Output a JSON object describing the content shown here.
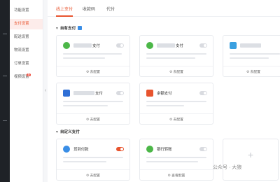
{
  "sidebar": {
    "items": [
      {
        "label": "功能设置",
        "active": false
      },
      {
        "label": "支付设置",
        "active": true
      },
      {
        "label": "配送设置",
        "active": false
      },
      {
        "label": "物流设置",
        "active": false
      },
      {
        "label": "订单设置",
        "active": false
      },
      {
        "label": "视频设置",
        "active": false,
        "badge": "新"
      }
    ]
  },
  "tabs": [
    {
      "label": "线上支付",
      "active": true
    },
    {
      "label": "收款码",
      "active": false
    },
    {
      "label": "代付",
      "active": false
    }
  ],
  "sections": {
    "own": {
      "title": "自有支付"
    },
    "custom": {
      "title": "自定义支付"
    }
  },
  "cards": {
    "wechat_pay": {
      "title": "支付",
      "enabled": false,
      "config_label": "去配置",
      "logo_color": "#4cb748"
    },
    "wechat_pay_2": {
      "title": "支付",
      "enabled": false,
      "config_label": "去配置",
      "logo_color": "#4cb748"
    },
    "third_pay": {
      "title": "",
      "enabled": false,
      "config_label": "去配置",
      "logo_color": "#3aa0e0"
    },
    "card_pay": {
      "title": "支付",
      "enabled": false,
      "config_label": "去配置",
      "logo_color": "#2f6fd6"
    },
    "balance_pay": {
      "title": "余额支付",
      "enabled": false,
      "config_label": "去配置",
      "logo_color": "#e8542e"
    },
    "cod_pay": {
      "title": "货到付款",
      "enabled": true,
      "config_label": "去配置",
      "logo_color": "#3a8ee6"
    },
    "bank_transfer": {
      "title": "银行转账",
      "enabled": false,
      "config_label": "查看配置",
      "logo_color": "#4cb748"
    }
  },
  "watermark": "公众号 · 大狼",
  "colors": {
    "accent": "#e8542e",
    "rail": "#1f2227"
  }
}
